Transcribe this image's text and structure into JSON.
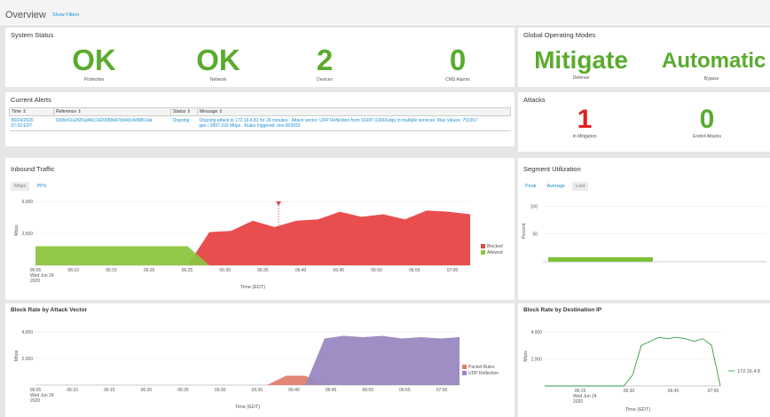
{
  "header": {
    "title": "Overview",
    "show_filters": "Show Filters"
  },
  "system_status": {
    "title": "System Status",
    "items": [
      {
        "value": "OK",
        "label": "Protection"
      },
      {
        "value": "OK",
        "label": "Network"
      },
      {
        "value": "2",
        "label": "Devices"
      },
      {
        "value": "0",
        "label": "CMS Alarms"
      }
    ]
  },
  "global_modes": {
    "title": "Global Operating Modes",
    "items": [
      {
        "value": "Mitigate",
        "label": "Defense"
      },
      {
        "value": "Automatic",
        "label": "Bypass"
      }
    ]
  },
  "current_alerts": {
    "title": "Current Alerts",
    "columns": [
      "Time ⇕",
      "Reference ⇕",
      "Status ⇕",
      "Message ⇕"
    ],
    "row": {
      "time_line1": "06/24/2020",
      "time_line2": "07:03 EDT",
      "reference": "33d9c61a2581af4b11420958d47bb43c4d9851da",
      "status": "Ongoing",
      "msg_line1": "Ongoing attack to 172.16.4.81 for 26 minutes . Attack vector: UDP Reflection from SSDP (1900/udp) to multiple services; Max Values: 751357",
      "msg_line2": "pps / 2897.233 Mbps . Rules triggered: ons-002033"
    }
  },
  "attacks": {
    "title": "Attacks",
    "items": [
      {
        "value": "1",
        "label": "In Mitigation",
        "color": "#e02020"
      },
      {
        "value": "0",
        "label": "Ended Attacks",
        "color": "#5aab2e"
      }
    ]
  },
  "inbound_traffic": {
    "title": "Inbound Traffic",
    "tabs": [
      "Mbps",
      "PPS"
    ],
    "ylabel": "Mbps",
    "xlabel": "Time (EDT)",
    "legend": [
      "Blocked",
      "Allowed"
    ]
  },
  "segment_utilization": {
    "title": "Segment Utilization",
    "tabs": [
      "Peak",
      "Average",
      "Last"
    ],
    "ylabel": "Percent"
  },
  "block_rate_vector": {
    "title": "Block Rate by Attack Vector",
    "ylabel": "Mbps",
    "xlabel": "Time (EDT)",
    "legend": [
      "Packet Rules",
      "UDP Reflection"
    ]
  },
  "block_rate_dest": {
    "title": "Block Rate by Destination IP",
    "ylabel": "Mbps",
    "xlabel": "Time (EDT)",
    "legend": [
      "172.16.4.8"
    ]
  },
  "chart_data": [
    {
      "type": "area",
      "title": "Inbound Traffic",
      "ylabel": "Mbps",
      "xlabel": "Time (EDT)",
      "ylim": [
        0,
        5500
      ],
      "yticks": [
        "5,000",
        "2,500"
      ],
      "x": [
        "06:05",
        "06:10",
        "06:15",
        "06:20",
        "06:25",
        "06:30",
        "06:35",
        "06:40",
        "06:45",
        "06:50",
        "06:55",
        "07:00"
      ],
      "x_first_sub": [
        "Wed Jun 24",
        "2020"
      ],
      "series": [
        {
          "name": "Blocked",
          "color": "#e84545",
          "values": [
            0,
            0,
            0,
            0,
            0,
            0,
            0,
            0,
            2600,
            2700,
            3500,
            3000,
            3500,
            3600,
            4200,
            3800,
            4000,
            3600,
            4300,
            4200,
            4000
          ]
        },
        {
          "name": "Allowed",
          "color": "#8cc63f",
          "values": [
            1500,
            1500,
            1500,
            1500,
            1500,
            1500,
            1500,
            1500,
            0,
            0,
            0,
            0,
            0,
            0,
            0,
            0,
            0,
            0,
            0,
            0,
            0
          ]
        }
      ]
    },
    {
      "type": "area",
      "title": "Block Rate by Attack Vector",
      "ylabel": "Mbps",
      "xlabel": "Time (EDT)",
      "ylim": [
        0,
        4400
      ],
      "yticks": [
        "4,000",
        "2,000"
      ],
      "x": [
        "06:05",
        "06:10",
        "06:15",
        "06:20",
        "06:25",
        "06:30",
        "06:35",
        "06:40",
        "06:45",
        "06:50",
        "06:55",
        "07:00"
      ],
      "x_first_sub": [
        "Wed Jun 24",
        "2020"
      ],
      "series": [
        {
          "name": "Packet Rules",
          "color": "#e08070",
          "values": [
            0,
            0,
            0,
            0,
            0,
            0,
            0,
            0,
            0,
            0,
            0,
            0,
            0,
            700,
            700,
            0,
            0,
            0,
            0,
            0,
            0,
            0,
            0
          ]
        },
        {
          "name": "UDP Reflection",
          "color": "#9988c0",
          "values": [
            0,
            0,
            0,
            0,
            0,
            0,
            0,
            0,
            0,
            0,
            0,
            0,
            0,
            0,
            0,
            3500,
            3700,
            3600,
            3700,
            3500,
            3600,
            3500,
            3600
          ]
        }
      ]
    },
    {
      "type": "bar",
      "title": "Segment Utilization",
      "ylabel": "Percent",
      "ylim": [
        0,
        110
      ],
      "yticks": [
        "100",
        "50"
      ],
      "categories": [
        "",
        "",
        ""
      ],
      "values": [
        8,
        0,
        0
      ]
    },
    {
      "type": "line",
      "title": "Block Rate by Destination IP",
      "ylabel": "Mbps",
      "xlabel": "Time (EDT)",
      "ylim": [
        0,
        4400
      ],
      "yticks": [
        "4,000",
        "2,000"
      ],
      "x": [
        "06:15",
        "06:30",
        "06:45",
        "07:00"
      ],
      "x_first_sub": [
        "Wed Jun 24",
        "2020"
      ],
      "series": [
        {
          "name": "172.16.4.8",
          "color": "#2e9e44",
          "values": [
            0,
            0,
            0,
            0,
            0,
            0,
            0,
            0,
            0,
            0,
            800,
            3000,
            3300,
            3600,
            3500,
            3600,
            3500,
            3300,
            3500,
            3000,
            0
          ]
        }
      ]
    }
  ]
}
